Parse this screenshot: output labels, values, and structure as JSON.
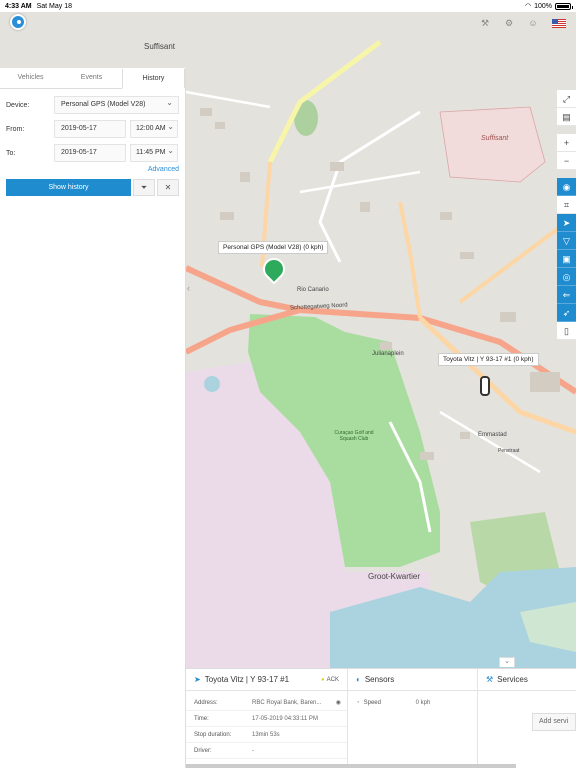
{
  "status_bar": {
    "time": "4:33 AM",
    "date": "Sat May 18",
    "wifi": "wifi-icon",
    "battery": "100%"
  },
  "tabs": [
    {
      "label": "Vehicles"
    },
    {
      "label": "Events"
    },
    {
      "label": "History"
    }
  ],
  "form": {
    "device_label": "Device:",
    "device_value": "Personal GPS (Model V28)",
    "from_label": "From:",
    "from_date": "2019-05-17",
    "from_time": "12:00 AM",
    "to_label": "To:",
    "to_date": "2019-05-17",
    "to_time": "11:45 PM",
    "advanced": "Advanced",
    "show_history": "Show history"
  },
  "map": {
    "labels": {
      "suffisant_top": "Suffisant",
      "suffisant_right": "Suffisant",
      "rio_canario": "Rio Canario",
      "golf_club": "Curaçao Golf and Squash Club",
      "groot_kwartier": "Groot-Kwartier",
      "emmastad": "Emmastad",
      "schottegatweg": "Schottegatweg Noord",
      "julianaplein": "Julianaplein",
      "penstraat": "Penstraat"
    },
    "tooltip_gps": "Personal GPS (Model V28) (0 kph)",
    "tooltip_car": "Toyota Vitz | Y 93-17 #1 (0 kph)",
    "colors": {
      "water": "#aad3df",
      "park": "#add19e",
      "golf": "#b5e3b5",
      "residential": "#e0dfdf",
      "industrial": "#ebdbe8",
      "major_road": "#f9b29c",
      "primary_road": "#fcd6a4",
      "accent": "#1f8ccf"
    }
  },
  "bottom": {
    "vehicle_title": "Toyota Vitz | Y 93-17 #1",
    "ack": "ACK",
    "rows": [
      {
        "key": "Address:",
        "value": "RBC Royal Bank, Baren..."
      },
      {
        "key": "Time:",
        "value": "17-05-2019 04:33:11 PM"
      },
      {
        "key": "Stop duration:",
        "value": "13min 53s"
      },
      {
        "key": "Driver:",
        "value": "-"
      }
    ],
    "sensors_title": "Sensors",
    "sensor_name": "Speed",
    "sensor_value": "0 kph",
    "services_title": "Services",
    "add_service": "Add servi"
  }
}
